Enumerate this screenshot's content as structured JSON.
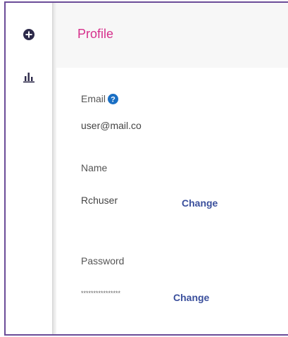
{
  "icons": {
    "add": "plus-circle-icon",
    "chart": "bar-chart-icon",
    "help": "question-mark-icon"
  },
  "colors": {
    "title": "#d6308c",
    "link": "#3a4f9c",
    "help": "#1a6fc4",
    "frame": "#6b4c98"
  },
  "header": {
    "title": "Profile"
  },
  "email": {
    "label": "Email",
    "value": "user@mail.co"
  },
  "name": {
    "label": "Name",
    "value": "Rchuser",
    "change_label": "Change"
  },
  "password": {
    "label": "Password",
    "value": "****************",
    "change_label": "Change"
  }
}
